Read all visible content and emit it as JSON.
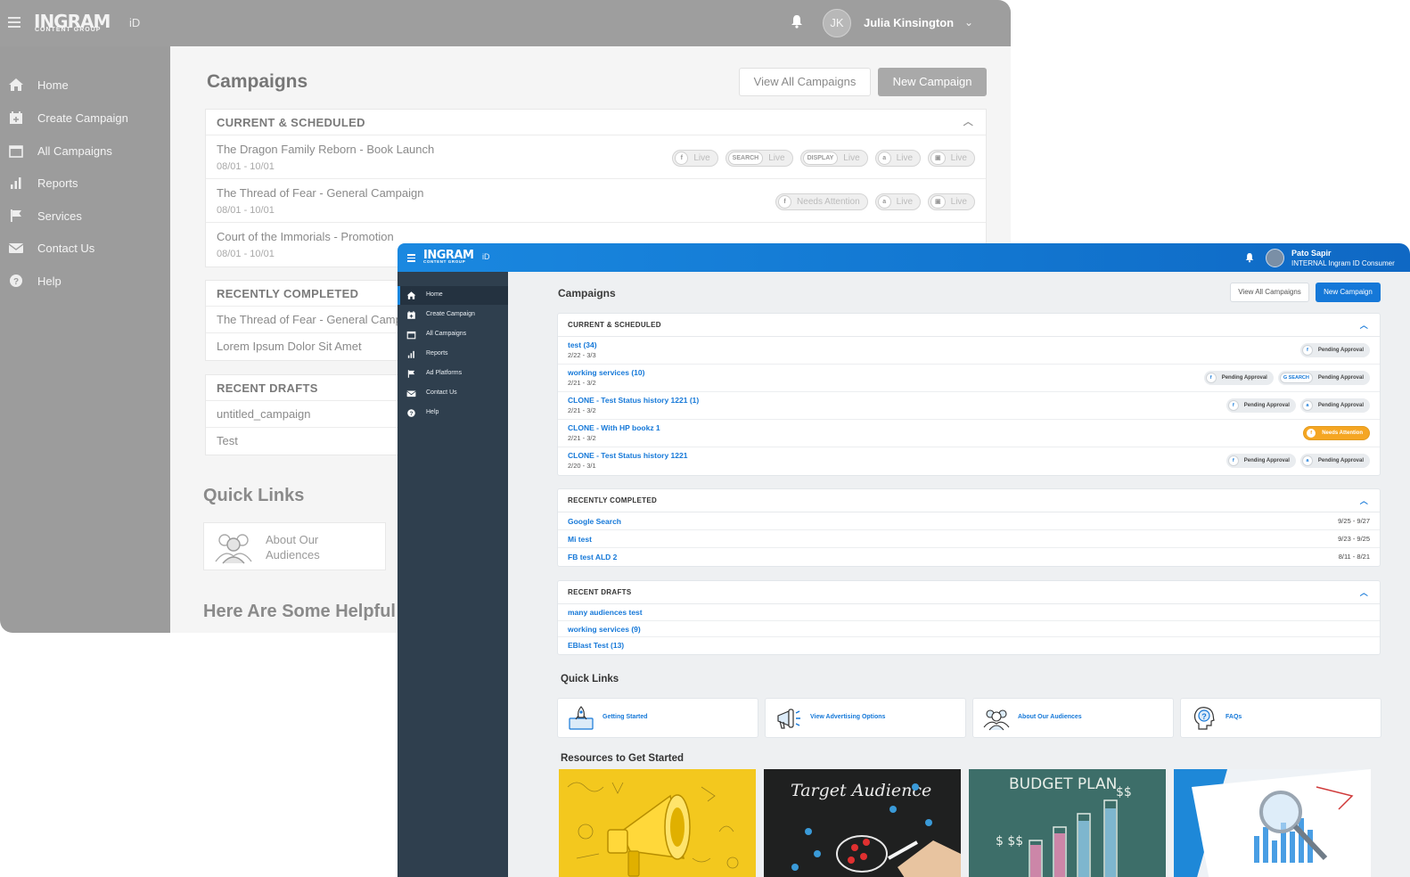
{
  "back_window": {
    "logo": "INGRAM",
    "logo_sub": "CONTENT GROUP",
    "id_label": "iD",
    "user": {
      "initials": "JK",
      "name": "Julia Kinsington"
    },
    "nav": [
      {
        "label": "Home",
        "icon": "home-icon"
      },
      {
        "label": "Create Campaign",
        "icon": "calendar-plus-icon"
      },
      {
        "label": "All Campaigns",
        "icon": "calendar-icon"
      },
      {
        "label": "Reports",
        "icon": "bar-chart-icon"
      },
      {
        "label": "Services",
        "icon": "flag-icon"
      },
      {
        "label": "Contact Us",
        "icon": "envelope-icon"
      },
      {
        "label": "Help",
        "icon": "help-circle-icon"
      }
    ],
    "title": "Campaigns",
    "view_all_label": "View All Campaigns",
    "new_campaign_label": "New Campaign",
    "current": {
      "heading": "CURRENT & SCHEDULED",
      "rows": [
        {
          "name": "The Dragon Family Reborn - Book Launch",
          "dates": "08/01 - 10/01",
          "pills": [
            {
              "channel": "f",
              "status": "Live"
            },
            {
              "channel": "SEARCH",
              "status": "Live"
            },
            {
              "channel": "DISPLAY",
              "status": "Live"
            },
            {
              "channel": "a",
              "status": "Live"
            },
            {
              "channel": "▣",
              "status": "Live"
            }
          ]
        },
        {
          "name": "The Thread of Fear - General Campaign",
          "dates": "08/01 - 10/01",
          "pills": [
            {
              "channel": "f",
              "status": "Needs Attention"
            },
            {
              "channel": "a",
              "status": "Live"
            },
            {
              "channel": "▣",
              "status": "Live"
            }
          ]
        },
        {
          "name": "Court of the Immorials - Promotion",
          "dates": "08/01 - 10/01",
          "pills": []
        }
      ]
    },
    "completed": {
      "heading": "RECENTLY COMPLETED",
      "rows": [
        "The Thread of Fear - General Campaign",
        "Lorem Ipsum Dolor Sit Amet"
      ]
    },
    "drafts": {
      "heading": "RECENT DRAFTS",
      "rows": [
        "untitled_campaign",
        "Test"
      ]
    },
    "quick_links_title": "Quick Links",
    "quick_link": "About Our Audiences",
    "helpful_title": "Here Are Some Helpful"
  },
  "front_window": {
    "logo": "INGRAM",
    "logo_sub": "CONTENT GROUP",
    "id_label": "iD",
    "user": {
      "name": "Pato Sapir",
      "role": "INTERNAL Ingram ID Consumer"
    },
    "nav": [
      {
        "label": "Home",
        "icon": "home-icon"
      },
      {
        "label": "Create Campaign",
        "icon": "calendar-plus-icon"
      },
      {
        "label": "All Campaigns",
        "icon": "calendar-icon"
      },
      {
        "label": "Reports",
        "icon": "bar-chart-icon"
      },
      {
        "label": "Ad Platforms",
        "icon": "flag-icon"
      },
      {
        "label": "Contact Us",
        "icon": "envelope-icon"
      },
      {
        "label": "Help",
        "icon": "help-circle-icon"
      }
    ],
    "title": "Campaigns",
    "view_all_label": "View All Campaigns",
    "new_campaign_label": "New Campaign",
    "current": {
      "heading": "CURRENT & SCHEDULED",
      "rows": [
        {
          "name": "test (34)",
          "dates": "2/22 - 3/3",
          "pills": [
            {
              "channel": "f",
              "status": "Pending Approval"
            }
          ]
        },
        {
          "name": "working services (10)",
          "dates": "2/21 - 3/2",
          "pills": [
            {
              "channel": "f",
              "status": "Pending Approval"
            },
            {
              "channel": "G SEARCH",
              "status": "Pending Approval"
            }
          ]
        },
        {
          "name": "CLONE - Test Status history 1221 (1)",
          "dates": "2/21 - 3/2",
          "pills": [
            {
              "channel": "f",
              "status": "Pending Approval"
            },
            {
              "channel": "a",
              "status": "Pending Approval"
            }
          ]
        },
        {
          "name": "CLONE - With HP bookz 1",
          "dates": "2/21 - 3/2",
          "pills": [
            {
              "channel": "f",
              "status": "Needs Attention",
              "warn": true
            }
          ]
        },
        {
          "name": "CLONE - Test Status history 1221",
          "dates": "2/20 - 3/1",
          "pills": [
            {
              "channel": "f",
              "status": "Pending Approval"
            },
            {
              "channel": "a",
              "status": "Pending Approval"
            }
          ]
        }
      ]
    },
    "completed": {
      "heading": "RECENTLY COMPLETED",
      "rows": [
        {
          "name": "Google Search",
          "dates": "9/25 - 9/27"
        },
        {
          "name": "Mi test",
          "dates": "9/23 - 9/25"
        },
        {
          "name": "FB test ALD 2",
          "dates": "8/11 - 8/21"
        }
      ]
    },
    "drafts": {
      "heading": "RECENT DRAFTS",
      "rows": [
        "many audiences test",
        "working services (9)",
        "EBlast Test (13)"
      ]
    },
    "quick_links_title": "Quick Links",
    "quick_links": [
      {
        "label": "Getting Started",
        "icon": "rocket-laptop-icon"
      },
      {
        "label": "View Advertising Options",
        "icon": "megaphone-icon"
      },
      {
        "label": "About Our Audiences",
        "icon": "audience-icon"
      },
      {
        "label": "FAQs",
        "icon": "question-head-icon"
      }
    ],
    "resources_title": "Resources to Get Started",
    "resources": [
      {
        "alt": "megaphone illustration",
        "text": ""
      },
      {
        "alt": "target audience chalkboard",
        "text": "Target Audience"
      },
      {
        "alt": "budget plan chalkboard",
        "text": "BUDGET PLAN"
      },
      {
        "alt": "analytics report with magnifier",
        "text": ""
      }
    ],
    "colors": {
      "accent": "#1578d8",
      "sidebar": "#2f3f4e",
      "warning": "#f5a623"
    }
  }
}
